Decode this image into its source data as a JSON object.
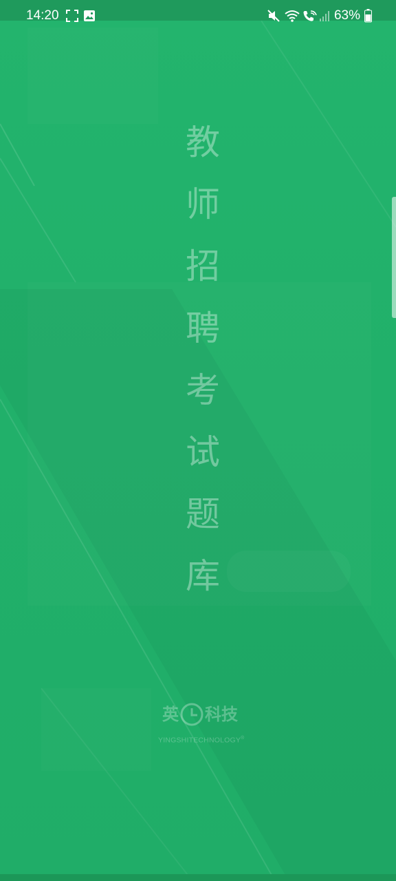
{
  "status_bar": {
    "time": "14:20",
    "battery_percent": "63%",
    "icons_left": [
      "screenshot-icon",
      "image-icon"
    ],
    "icons_right": [
      "mute-icon",
      "wifi-icon",
      "wifi-calling-icon",
      "signal-icon",
      "battery-icon"
    ]
  },
  "splash": {
    "title_chars": [
      "教",
      "师",
      "招",
      "聘",
      "考",
      "试",
      "题",
      "库"
    ]
  },
  "logo": {
    "cn_left": "英",
    "cn_right": "科技",
    "en": "YINGSHITECHNOLOGY",
    "registered_mark": "®"
  },
  "colors": {
    "background": "#22b06a",
    "status_bar": "#1f9a5c",
    "title_text": "rgba(255,255,255,0.36)"
  }
}
